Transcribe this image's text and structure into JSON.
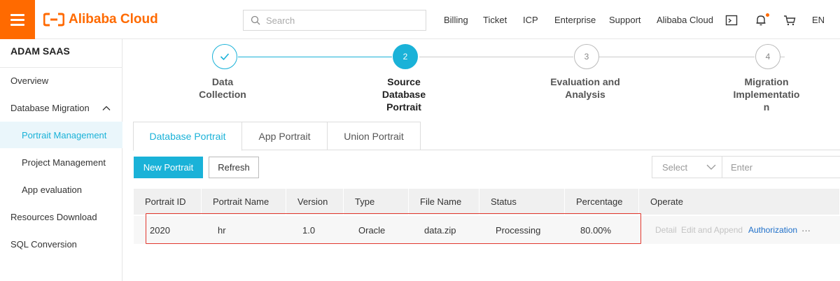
{
  "header": {
    "logo_text": "Alibaba Cloud",
    "search_placeholder": "Search",
    "nav": [
      "Billing",
      "Ticket",
      "ICP",
      "Enterprise",
      "Support",
      "Alibaba Cloud"
    ],
    "lang": "EN",
    "brand_color": "#ff6a00"
  },
  "sidebar": {
    "title": "ADAM SAAS",
    "items": [
      {
        "label": "Overview"
      },
      {
        "label": "Database Migration"
      },
      {
        "label": "Portrait Management"
      },
      {
        "label": "Project Management"
      },
      {
        "label": "App evaluation"
      },
      {
        "label": "Resources Download"
      },
      {
        "label": "SQL Conversion"
      }
    ]
  },
  "steps": [
    {
      "number": "1",
      "label_lines": [
        "Data",
        "Collection"
      ],
      "state": "done"
    },
    {
      "number": "2",
      "label_lines": [
        "Source",
        "Database",
        "Portrait"
      ],
      "state": "active"
    },
    {
      "number": "3",
      "label_lines": [
        "Evaluation and",
        "Analysis"
      ],
      "state": "pending"
    },
    {
      "number": "4",
      "label_lines": [
        "Migration",
        "Implementatio",
        "n"
      ],
      "state": "pending"
    }
  ],
  "tabs": [
    "Database Portrait",
    "App Portrait",
    "Union Portrait"
  ],
  "toolbar": {
    "new_label": "New Portrait",
    "refresh_label": "Refresh",
    "select_placeholder": "Select",
    "enter_placeholder": "Enter"
  },
  "table": {
    "columns": [
      "Portrait ID",
      "Portrait Name",
      "Version",
      "Type",
      "File Name",
      "Status",
      "Percentage",
      "Operate"
    ],
    "rows": [
      {
        "id": "2020",
        "name": "hr",
        "version": "1.0",
        "type": "Oracle",
        "file": "data.zip",
        "status": "Processing",
        "percentage": "80.00%",
        "ops": {
          "detail": "Detail",
          "edit": "Edit and Append",
          "auth": "Authorization",
          "more": "···"
        }
      }
    ]
  },
  "accent_color": "#1ab2d8"
}
